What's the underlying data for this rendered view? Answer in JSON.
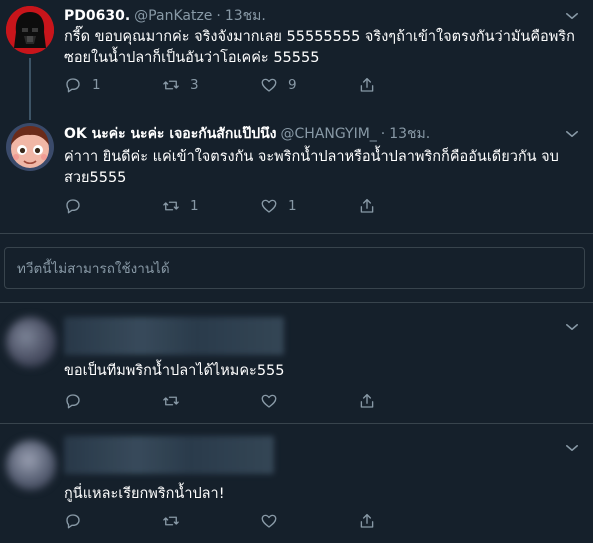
{
  "tweets": [
    {
      "display_name": "PD0630.",
      "handle": "@PanKatze",
      "separator": "·",
      "time": "13ชม.",
      "text": "กรี๊ด ขอบคุณมากค่ะ จริงจังมากเลย 55555555 จริงๆถ้าเข้าใจตรงกันว่ามันคือพริกซอยในน้ำปลาก็เป็นอันว่าโอเคค่ะ 55555",
      "reply_count": "1",
      "retweet_count": "3",
      "like_count": "9"
    },
    {
      "display_name": "OK นะค่ะ นะค่ะ เจอะกันสักแป๊ปนึง",
      "handle": "@CHANGYIM_",
      "separator": "·",
      "time": "13ชม.",
      "text": "ค่าาา ยินดีค่ะ แค่เข้าใจตรงกัน จะพริกน้ำปลาหรือน้ำปลาพริกก็คืออันเดียวกัน จบสวย5555",
      "reply_count": "",
      "retweet_count": "1",
      "like_count": "1"
    }
  ],
  "reply_box": {
    "placeholder": "ทวีตนี้ไม่สามารถใช้งานได้"
  },
  "replies": [
    {
      "text": "ขอเป็นทีมพริกน้ำปลาได้ไหมคะ555"
    },
    {
      "text": "กูนี่แหละเรียกพริกน้ำปลา!"
    }
  ],
  "colors": {
    "background": "#15202b",
    "secondary_text": "#8899a6",
    "divider": "#38444d"
  },
  "icons": [
    "chevron-down-icon",
    "reply-icon",
    "retweet-icon",
    "like-icon",
    "share-icon"
  ]
}
